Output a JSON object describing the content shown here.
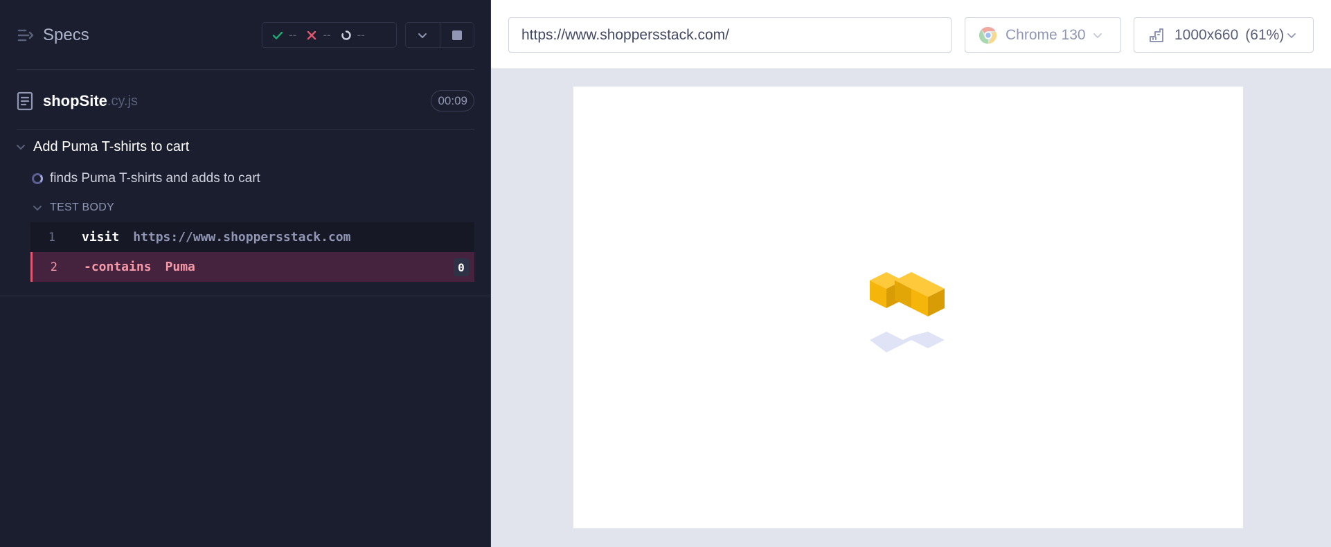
{
  "left_panel": {
    "specs_title": "Specs",
    "stats": {
      "passed": "--",
      "failed": "--",
      "pending": "--"
    },
    "spec_file": {
      "name": "shopSite",
      "ext": ".cy.js",
      "duration": "00:09"
    },
    "suite": {
      "title": "Add Puma T-shirts to cart"
    },
    "test": {
      "title": "finds Puma T-shirts and adds to cart",
      "body_label": "TEST BODY",
      "commands": [
        {
          "num": "1",
          "name": "visit",
          "arg": "https://www.shoppersstack.com"
        },
        {
          "num": "2",
          "name": "-contains",
          "arg": "Puma",
          "count": "0"
        }
      ]
    }
  },
  "right_panel": {
    "url": "https://www.shoppersstack.com/",
    "browser": "Chrome 130",
    "viewport": "1000x660",
    "scale": "(61%)"
  },
  "colors": {
    "sidebar_bg": "#1b1e2e",
    "failed_row_bg": "#45233f",
    "failed_accent": "#e45770",
    "pass_green": "#1fa971",
    "loader_yellow": "#f5b50a"
  }
}
